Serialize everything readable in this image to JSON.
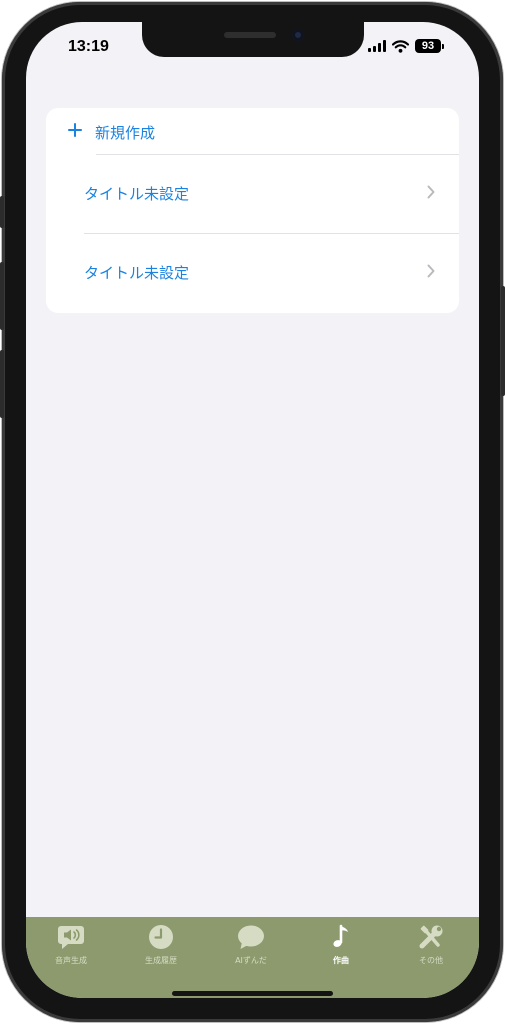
{
  "status_bar": {
    "time": "13:19",
    "battery": "93",
    "icons": [
      "cellular-signal-icon",
      "wifi-icon",
      "battery-icon"
    ]
  },
  "list": {
    "new_item_label": "新規作成",
    "new_item_icon": "plus-icon",
    "items": [
      {
        "label": "タイトル未設定"
      },
      {
        "label": "タイトル未設定"
      }
    ],
    "row_icon": "chevron-right-icon"
  },
  "tab_bar": {
    "background": "#8c9a6e",
    "tabs": [
      {
        "label": "音声生成",
        "icon": "speech-bubble-speaker-icon",
        "active": false
      },
      {
        "label": "生成履歴",
        "icon": "clock-icon",
        "active": false
      },
      {
        "label": "AIずんだ",
        "icon": "chat-bubble-icon",
        "active": false
      },
      {
        "label": "作曲",
        "icon": "music-note-icon",
        "active": true
      },
      {
        "label": "その他",
        "icon": "tools-icon",
        "active": false
      }
    ]
  },
  "colors": {
    "accent": "#1a82e0",
    "screen_background": "#f2f2f7",
    "card_background": "#ffffff",
    "tab_active": "#ffffff",
    "tab_inactive": "#d6dcc4"
  }
}
